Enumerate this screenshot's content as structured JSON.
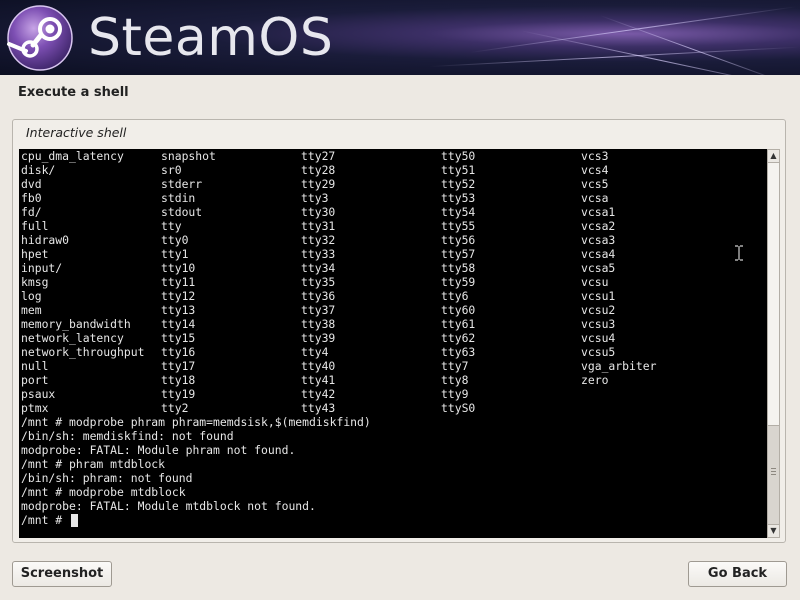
{
  "header": {
    "brand": "SteamOS",
    "logo_icon": "steam-logo-icon"
  },
  "page": {
    "title": "Execute a shell"
  },
  "shell": {
    "legend": "Interactive shell",
    "listing": [
      [
        "cpu_dma_latency",
        "snapshot",
        "tty27",
        "tty50",
        "vcs3"
      ],
      [
        "disk/",
        "sr0",
        "tty28",
        "tty51",
        "vcs4"
      ],
      [
        "dvd",
        "stderr",
        "tty29",
        "tty52",
        "vcs5"
      ],
      [
        "fb0",
        "stdin",
        "tty3",
        "tty53",
        "vcsa"
      ],
      [
        "fd/",
        "stdout",
        "tty30",
        "tty54",
        "vcsa1"
      ],
      [
        "full",
        "tty",
        "tty31",
        "tty55",
        "vcsa2"
      ],
      [
        "hidraw0",
        "tty0",
        "tty32",
        "tty56",
        "vcsa3"
      ],
      [
        "hpet",
        "tty1",
        "tty33",
        "tty57",
        "vcsa4"
      ],
      [
        "input/",
        "tty10",
        "tty34",
        "tty58",
        "vcsa5"
      ],
      [
        "kmsg",
        "tty11",
        "tty35",
        "tty59",
        "vcsu"
      ],
      [
        "log",
        "tty12",
        "tty36",
        "tty6",
        "vcsu1"
      ],
      [
        "mem",
        "tty13",
        "tty37",
        "tty60",
        "vcsu2"
      ],
      [
        "memory_bandwidth",
        "tty14",
        "tty38",
        "tty61",
        "vcsu3"
      ],
      [
        "network_latency",
        "tty15",
        "tty39",
        "tty62",
        "vcsu4"
      ],
      [
        "network_throughput",
        "tty16",
        "tty4",
        "tty63",
        "vcsu5"
      ],
      [
        "null",
        "tty17",
        "tty40",
        "tty7",
        "vga_arbiter"
      ],
      [
        "port",
        "tty18",
        "tty41",
        "tty8",
        "zero"
      ],
      [
        "psaux",
        "tty19",
        "tty42",
        "tty9",
        ""
      ],
      [
        "ptmx",
        "tty2",
        "tty43",
        "ttyS0",
        ""
      ]
    ],
    "output_lines": [
      "/mnt # modprobe phram phram=memdsisk,$(memdiskfind)",
      "/bin/sh: memdiskfind: not found",
      "modprobe: FATAL: Module phram not found.",
      "/mnt # phram mtdblock",
      "/bin/sh: phram: not found",
      "/mnt # modprobe mtdblock",
      "modprobe: FATAL: Module mtdblock not found."
    ],
    "prompt": "/mnt # "
  },
  "buttons": {
    "screenshot": "Screenshot",
    "go_back": "Go Back"
  },
  "icons": {
    "scroll_up": "scroll-up-arrow-icon",
    "scroll_down": "scroll-down-arrow-icon",
    "pointer": "text-cursor-icon"
  },
  "colors": {
    "terminal_bg": "#000000",
    "terminal_fg": "#e6e6e6",
    "window_bg": "#ede9e3"
  }
}
